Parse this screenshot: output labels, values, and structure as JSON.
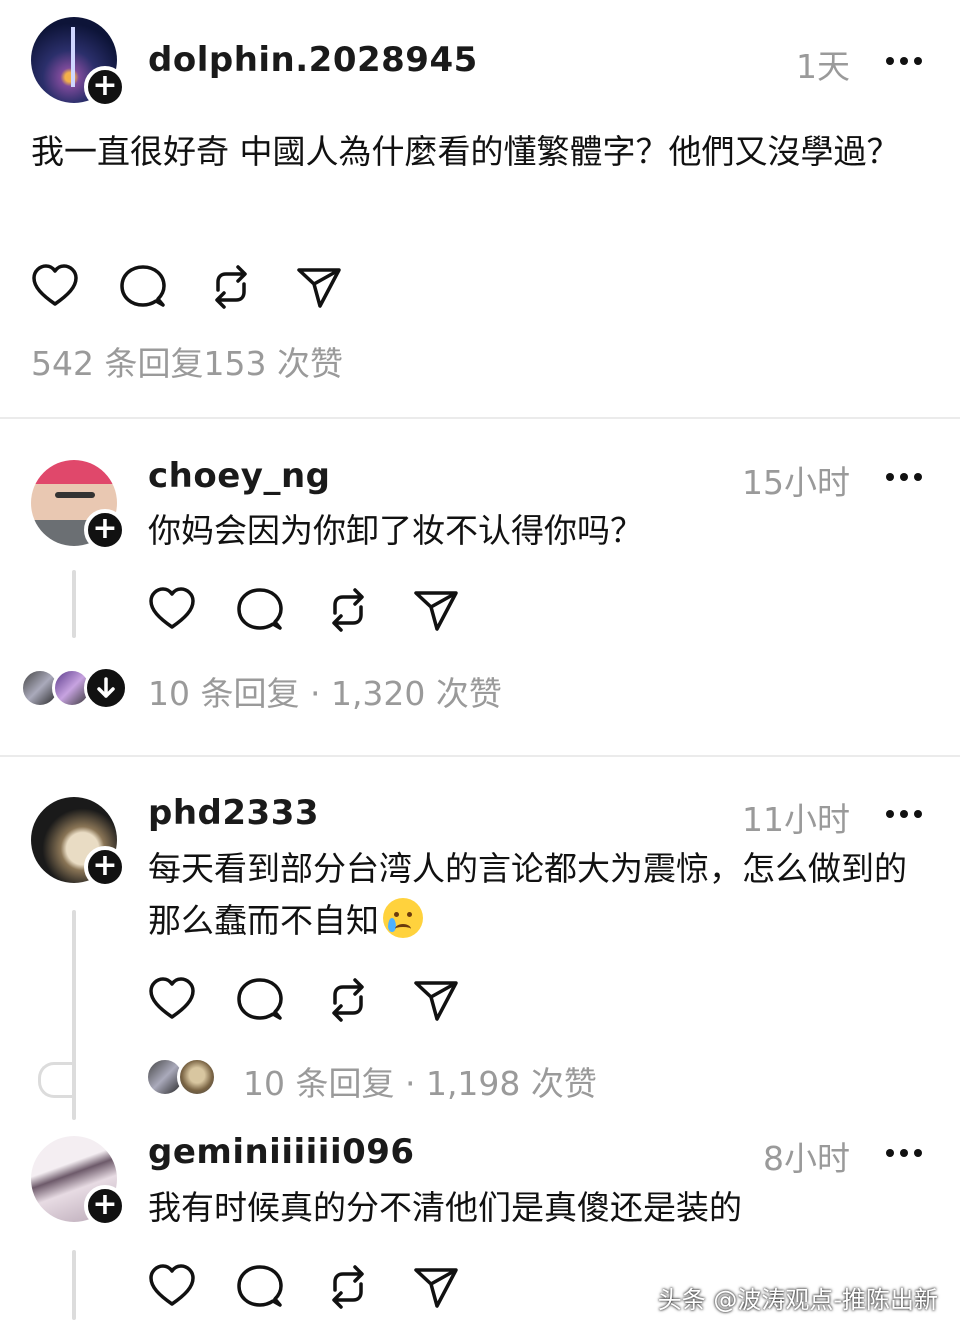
{
  "post": {
    "username": "dolphin.2028945",
    "time": "1天",
    "text": "我一直很好奇 中國人為什麼看的懂繁體字？他們又沒學過？",
    "stats": "542 条回复153 次赞"
  },
  "comments": [
    {
      "username": "choey_ng",
      "time": "15小时",
      "text": "你妈会因为你卸了妆不认得你吗？",
      "stats": "10 条回复 · 1,320 次赞"
    },
    {
      "username": "phd2333",
      "time": "11小时",
      "text": "每天看到部分台湾人的言论都大为震惊，怎么做到的那么蠢而不自知",
      "stats": "10 条回复 · 1,198 次赞"
    },
    {
      "username": "geminiiiiii096",
      "time": "8小时",
      "text": "我有时候真的分不清他们是真傻还是装的"
    }
  ],
  "icons": {
    "like": "heart-icon",
    "reply": "comment-bubble-icon",
    "repost": "repost-icon",
    "share": "send-icon",
    "more": "more-dots-icon",
    "follow": "plus-icon",
    "expand": "chevron-down-icon"
  },
  "watermark": "头条 @波涛观点-推陈出新"
}
